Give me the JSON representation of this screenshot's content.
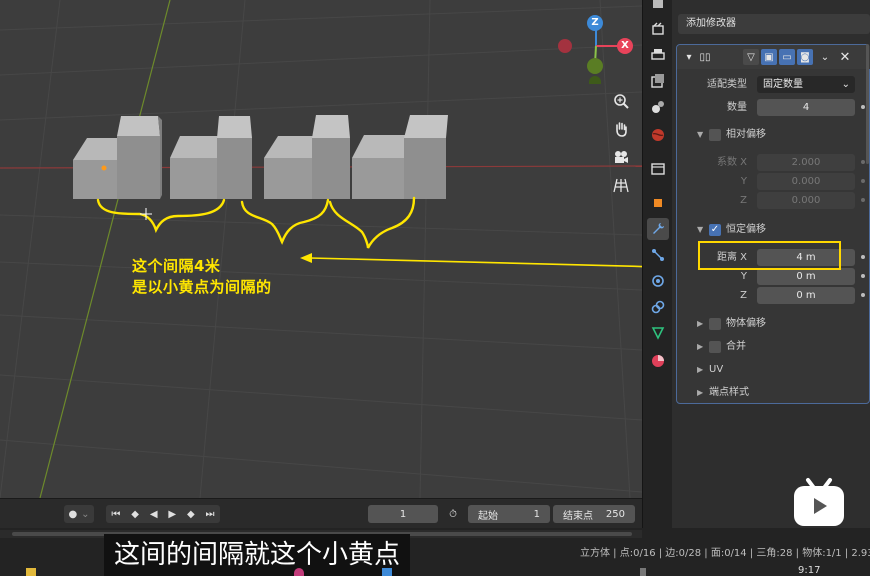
{
  "viewport": {
    "gizmo": {
      "z_label": "Z",
      "x_label": "X"
    },
    "nav_tools": [
      "zoom-icon",
      "hand-pan-icon",
      "camera-icon",
      "grid-icon"
    ]
  },
  "annotation": {
    "line1": "这个间隔4米",
    "line2": "是以小黄点为间隔的"
  },
  "timeline": {
    "current_frame": "1",
    "start_label": "起始",
    "start_value": "1",
    "end_label": "结束点",
    "end_value": "250"
  },
  "subtitle": "这间的间隔就这个小黄点",
  "statusbar": "立方体 | 点:0/16 | 边:0/28 | 面:0/14 | 三角:28 | 物体:1/1 | 2.93.",
  "clock": "9:17",
  "properties": {
    "add_modifier": "添加修改器",
    "modifier_name": "",
    "fit_type_label": "适配类型",
    "fit_type_value": "固定数量",
    "count_label": "数量",
    "count_value": "4",
    "relative_offset_label": "相对偏移",
    "factor_label": "系数 X",
    "factor_x": "2.000",
    "y_label": "Y",
    "factor_y": "0.000",
    "z_label": "Z",
    "factor_z": "0.000",
    "constant_offset_label": "恒定偏移",
    "distance_label": "距离 X",
    "distance_x": "4 m",
    "distance_y": "0 m",
    "distance_z": "0 m",
    "object_offset_label": "物体偏移",
    "merge_label": "合并",
    "uv_label": "UV",
    "caps_label": "端点样式"
  },
  "colors": {
    "annotation": "#ffe600",
    "highlight": "#ffd800",
    "accent": "#4772b3",
    "axis_x": "#e8435a",
    "axis_y": "#8bc34a",
    "axis_z": "#3d8ad8"
  }
}
